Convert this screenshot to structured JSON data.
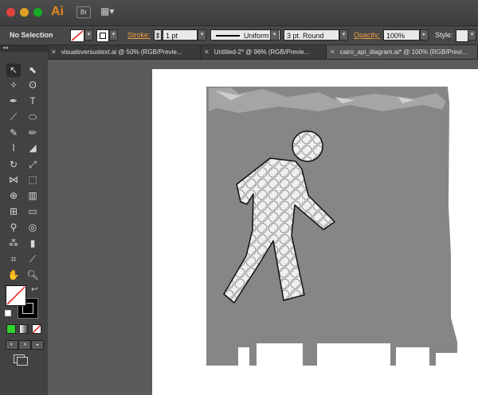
{
  "app": {
    "logo": "Ai",
    "bridge_label": "Br",
    "workspace_icon": "workspace-switcher-icon"
  },
  "control_bar": {
    "selection": "No Selection",
    "stroke_label": "Stroke:",
    "stroke_weight": "1 pt",
    "stroke_profile": "Uniform",
    "brush": "3 pt. Round",
    "opacity_label": "Opacity:",
    "opacity_value": "100%",
    "style_label": "Style:"
  },
  "tabs": [
    {
      "label": "visualsversustext.ai @ 50% (RGB/Previe..."
    },
    {
      "label": "Untitled-2* @ 96% (RGB/Previe..."
    },
    {
      "label": "cairo_api_diagram.ai* @ 100% (RGB/Previ..."
    }
  ],
  "tools_panel": {
    "collapse_arrows": "◂◂"
  },
  "colors": {
    "accent": "#f0a040",
    "sign_gray": "#888888",
    "figure_outline": "#111111"
  }
}
